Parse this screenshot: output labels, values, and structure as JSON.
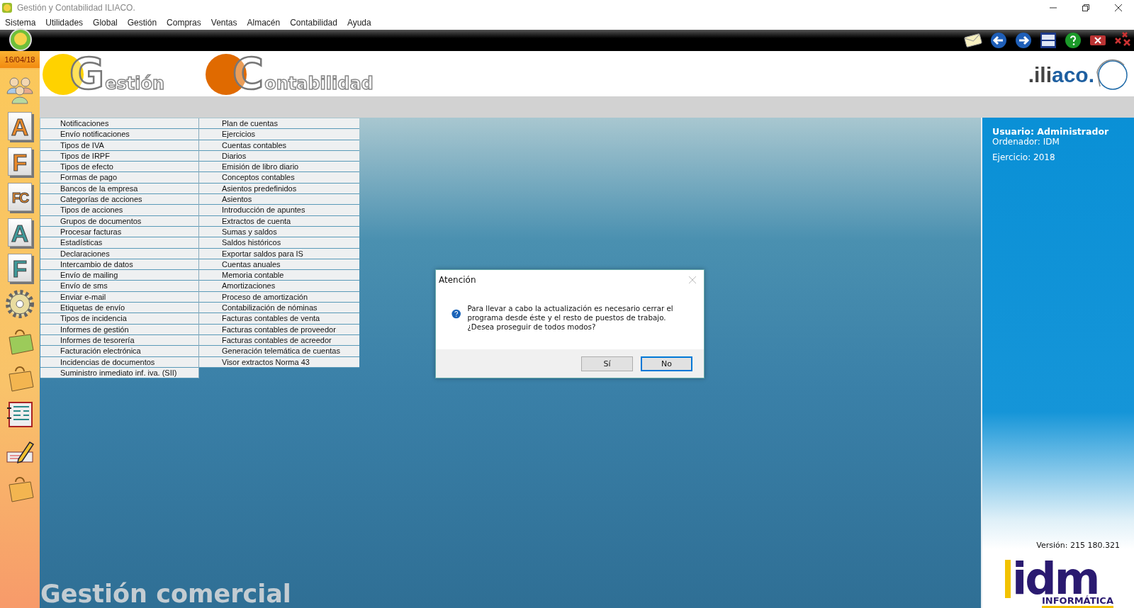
{
  "window": {
    "title": "Gestión y Contabilidad ILIACO."
  },
  "menu": [
    "Sistema",
    "Utilidades",
    "Global",
    "Gestión",
    "Compras",
    "Ventas",
    "Almacén",
    "Contabilidad",
    "Ayuda"
  ],
  "date": "16/04/18",
  "sidebar": [
    {
      "kind": "people"
    },
    {
      "kind": "letter",
      "text": "A",
      "color": "#e8892b"
    },
    {
      "kind": "letter",
      "text": "F",
      "color": "#e8892b"
    },
    {
      "kind": "letter",
      "text": "FC",
      "color": "#e8892b"
    },
    {
      "kind": "letter",
      "text": "A",
      "color": "#3f9a9a"
    },
    {
      "kind": "letter",
      "text": "F",
      "color": "#3f9a9a"
    },
    {
      "kind": "gear"
    },
    {
      "kind": "bag",
      "color": "#9ccb5a"
    },
    {
      "kind": "bag",
      "color": "#f3b550"
    },
    {
      "kind": "notebook"
    },
    {
      "kind": "pencil"
    },
    {
      "kind": "bag",
      "color": "#f3b550"
    }
  ],
  "header": {
    "logos": [
      {
        "initial": "G",
        "rest": "estión",
        "color": "#ffd200"
      },
      {
        "initial": "C",
        "rest": "ontabilidad",
        "color": "#e06a00"
      }
    ],
    "brand_grey": ".ili",
    "brand_blue": "aco."
  },
  "gestion_menu": [
    "Notificaciones",
    "Envío notificaciones",
    "Tipos de IVA",
    "Tipos de IRPF",
    "Tipos de efecto",
    "Formas de pago",
    "Bancos de la empresa",
    "Categorías de acciones",
    "Tipos de acciones",
    "Grupos de documentos",
    "Procesar facturas",
    "Estadísticas",
    "Declaraciones",
    "Intercambio de datos",
    "Envío de mailing",
    "Envío de sms",
    "Enviar e-mail",
    "Etiquetas de envío",
    "Tipos de incidencia",
    "Informes de gestión",
    "Informes de tesorería",
    "Facturación electrónica",
    "Incidencias de documentos",
    "Suministro inmediato inf. iva. (SII)"
  ],
  "contabilidad_menu": [
    "Plan de cuentas",
    "Ejercicios",
    "Cuentas contables",
    "Diarios",
    "Emisión de libro diario",
    "Conceptos contables",
    "Asientos predefinidos",
    "Asientos",
    "Introducción de apuntes",
    "Extractos de cuenta",
    "Sumas y saldos",
    "Saldos históricos",
    "Exportar saldos para IS",
    "Cuentas anuales",
    "Memoria contable",
    "Amortizaciones",
    "Proceso de amortización",
    "Contabilización de nóminas",
    "Facturas contables de venta",
    "Facturas contables de proveedor",
    "Facturas contables de acreedor",
    "Generación telemática de cuentas",
    "Visor extractos Norma 43"
  ],
  "footer_title": "Gestión comercial",
  "info": {
    "user": "Usuario: Administrador",
    "computer": "Ordenador: IDM",
    "year": "Ejercicio: 2018",
    "version": "Versión: 215 180.321",
    "company": "idm",
    "company_sub": "INFORMÁTICA"
  },
  "dialog": {
    "title": "Atención",
    "message": "Para llevar a cabo la actualización es necesario cerrar el programa desde éste y el resto de puestos de trabajo. ¿Desea proseguir de todos modos?",
    "buttons": [
      {
        "label": "Sí",
        "selected": false
      },
      {
        "label": "No",
        "selected": true
      }
    ]
  }
}
